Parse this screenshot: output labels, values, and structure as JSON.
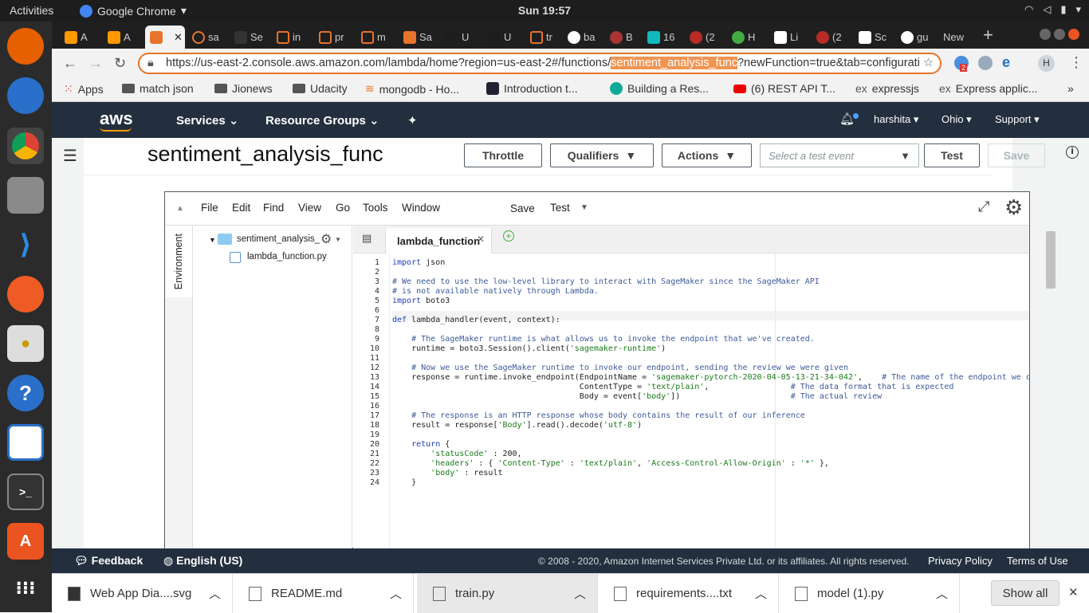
{
  "topbar": {
    "activities": "Activities",
    "app": "Google Chrome",
    "clock": "Sun 19:57"
  },
  "tabs": [
    {
      "label": "A"
    },
    {
      "label": "A"
    },
    {
      "label": ""
    },
    {
      "label": "sa"
    },
    {
      "label": "Se"
    },
    {
      "label": "in"
    },
    {
      "label": "pr"
    },
    {
      "label": "m"
    },
    {
      "label": "Sa"
    },
    {
      "label": "U"
    },
    {
      "label": "U"
    },
    {
      "label": "tr"
    },
    {
      "label": "ba"
    },
    {
      "label": "B"
    },
    {
      "label": "16"
    },
    {
      "label": "(2"
    },
    {
      "label": "H"
    },
    {
      "label": "Li"
    },
    {
      "label": "(2"
    },
    {
      "label": "Sc"
    },
    {
      "label": "gu"
    },
    {
      "label": "New"
    }
  ],
  "address": {
    "url_pre": "https://us-east-2.console.aws.amazon.com/lambda/home?region=us-east-2#/functions/",
    "url_hl": "sentiment_analysis_func",
    "url_post": "?newFunction=true&tab=configurati",
    "badge": "2",
    "profile": "H"
  },
  "bookmarks": [
    "Apps",
    "match json",
    "Jionews",
    "Udacity",
    "mongodb - Ho...",
    "Introduction t...",
    "Building a Res...",
    "(6) REST API T...",
    "expressjs",
    "Express applic..."
  ],
  "bookmark_prefix": "ex",
  "awsnav": {
    "logo": "aws",
    "services": "Services",
    "resource_groups": "Resource Groups",
    "user": "harshita",
    "region": "Ohio",
    "support": "Support"
  },
  "function": {
    "name": "sentiment_analysis_func",
    "throttle": "Throttle",
    "qualifiers": "Qualifiers",
    "actions": "Actions",
    "select_test": "Select a test event",
    "test": "Test",
    "save": "Save"
  },
  "ide": {
    "menu": [
      "File",
      "Edit",
      "Find",
      "View",
      "Go",
      "Tools",
      "Window"
    ],
    "save": "Save",
    "test": "Test",
    "environment": "Environment",
    "folder": "sentiment_analysis_",
    "file": "lambda_function.py",
    "tab": "lambda_function"
  },
  "code": [
    "import json",
    "",
    "# We need to use the low-level library to interact with SageMaker since the SageMaker API",
    "# is not available natively through Lambda.",
    "import boto3",
    "",
    "def lambda_handler(event, context):",
    "",
    "    # The SageMaker runtime is what allows us to invoke the endpoint that we've created.",
    "    runtime = boto3.Session().client('sagemaker-runtime')",
    "",
    "    # Now we use the SageMaker runtime to invoke our endpoint, sending the review we were given",
    "    response = runtime.invoke_endpoint(EndpointName = 'sagemaker-pytorch-2020-04-05-13-21-34-042',    # The name of the endpoint we c",
    "                                       ContentType = 'text/plain',                 # The data format that is expected",
    "                                       Body = event['body'])                       # The actual review",
    "",
    "    # The response is an HTTP response whose body contains the result of our inference",
    "    result = response['Body'].read().decode('utf-8')",
    "",
    "    return {",
    "        'statusCode' : 200,",
    "        'headers' : { 'Content-Type' : 'text/plain', 'Access-Control-Allow-Origin' : '*' },",
    "        'body' : result",
    "    }"
  ],
  "footer": {
    "feedback": "Feedback",
    "language": "English (US)",
    "copyright": "© 2008 - 2020, Amazon Internet Services Private Ltd. or its affiliates. All rights reserved.",
    "privacy": "Privacy Policy",
    "terms": "Terms of Use"
  },
  "downloads": [
    {
      "name": "Web App Dia....svg"
    },
    {
      "name": "README.md"
    },
    {
      "name": "train.py"
    },
    {
      "name": "requirements....txt"
    },
    {
      "name": "model (1).py"
    }
  ],
  "show_all": "Show all"
}
